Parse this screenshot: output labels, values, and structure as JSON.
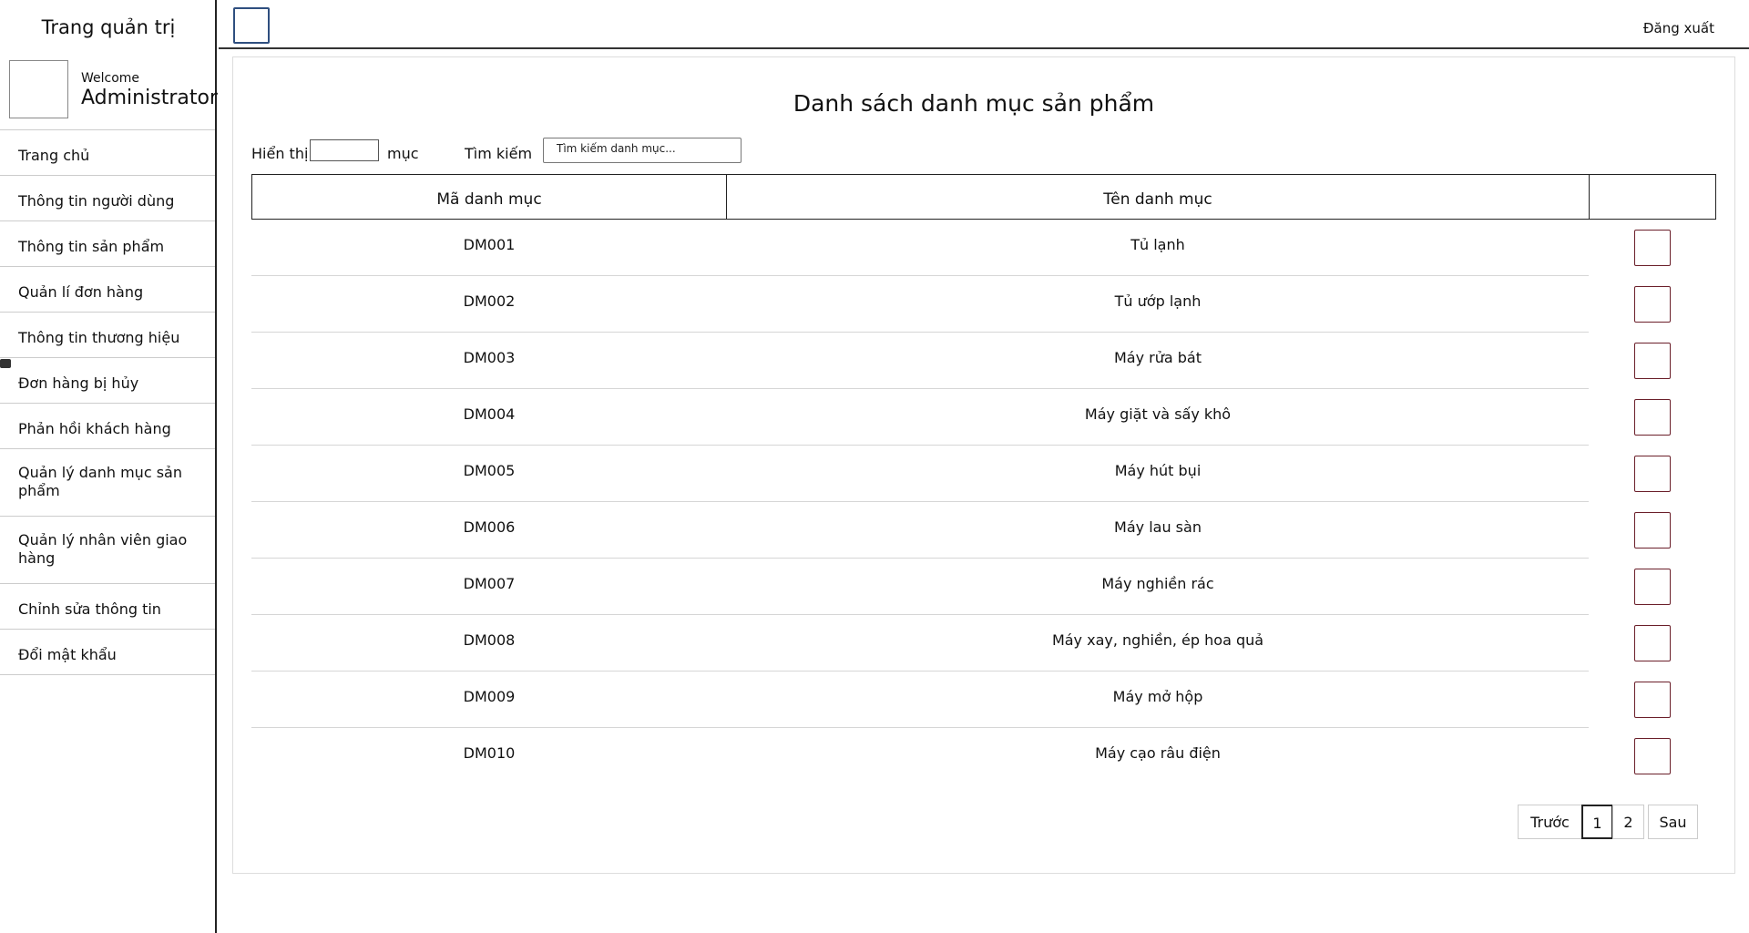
{
  "sidebar": {
    "title": "Trang quản trị",
    "welcome_small": "Welcome",
    "welcome_user": "Administrator",
    "items": [
      {
        "label": "Trang chủ"
      },
      {
        "label": "Thông tin người dùng"
      },
      {
        "label": "Thông tin sản phẩm"
      },
      {
        "label": "Quản lí đơn hàng"
      },
      {
        "label": "Thông tin thương hiệu"
      },
      {
        "label": "Đơn hàng bị hủy"
      },
      {
        "label": "Phản hồi khách hàng"
      },
      {
        "label": "Quản lý danh mục sản phẩm"
      },
      {
        "label": "Quản lý nhân viên giao hàng"
      },
      {
        "label": "Chỉnh sửa thông tin"
      },
      {
        "label": "Đổi mật khẩu"
      }
    ]
  },
  "topbar": {
    "logout_label": "Đăng xuất"
  },
  "main": {
    "title": "Danh sách danh mục sản phẩm",
    "show_label": "Hiển thị",
    "show_suffix": "mục",
    "search_label": "Tìm kiếm",
    "search_placeholder": "Tìm kiếm danh mục..."
  },
  "table": {
    "headers": [
      "Mã danh mục",
      "Tên danh mục",
      ""
    ],
    "rows": [
      {
        "code": "DM001",
        "name": "Tủ lạnh"
      },
      {
        "code": "DM002",
        "name": "Tủ ướp lạnh"
      },
      {
        "code": "DM003",
        "name": "Máy rửa bát"
      },
      {
        "code": "DM004",
        "name": "Máy giặt và sấy khô"
      },
      {
        "code": "DM005",
        "name": "Máy hút bụi"
      },
      {
        "code": "DM006",
        "name": "Máy lau sàn"
      },
      {
        "code": "DM007",
        "name": "Máy nghiền rác"
      },
      {
        "code": "DM008",
        "name": "Máy xay, nghiền, ép hoa quả"
      },
      {
        "code": "DM009",
        "name": "Máy mở hộp"
      },
      {
        "code": "DM010",
        "name": "Máy cạo râu điện"
      }
    ]
  },
  "pagination": {
    "prev": "Trước",
    "pages": [
      "1",
      "2"
    ],
    "next": "Sau"
  },
  "colors": {
    "checkbox_border": "#6b1f2a",
    "topbar_square_border": "#2f4f7f"
  }
}
